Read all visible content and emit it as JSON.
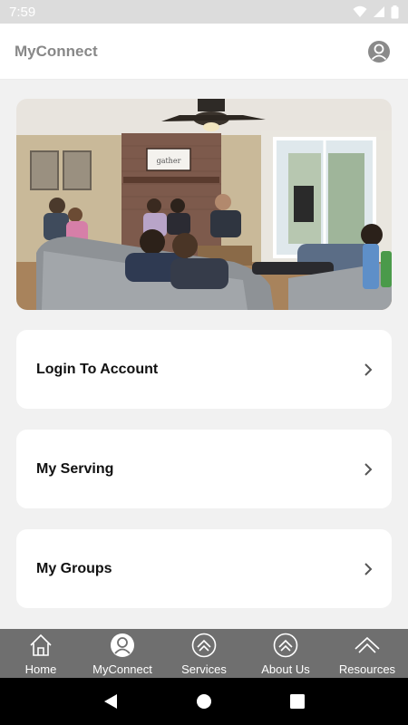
{
  "status_bar": {
    "time": "7:59",
    "icons": [
      "wifi-icon",
      "signal-icon",
      "battery-icon"
    ]
  },
  "header": {
    "title": "MyConnect",
    "profile_icon": "account-circle-icon"
  },
  "hero": {
    "image": "photo of a group gathered in a living room"
  },
  "cards": [
    {
      "label": "Login To Account",
      "icon": "chevron-right-icon"
    },
    {
      "label": "My Serving",
      "icon": "chevron-right-icon"
    },
    {
      "label": "My Groups",
      "icon": "chevron-right-icon"
    }
  ],
  "tabs": [
    {
      "label": "Home",
      "icon": "home-icon"
    },
    {
      "label": "MyConnect",
      "icon": "account-circle-icon"
    },
    {
      "label": "Services",
      "icon": "chevron-up-circle-icon"
    },
    {
      "label": "About Us",
      "icon": "chevron-up-circle-icon"
    },
    {
      "label": "Resources",
      "icon": "chevron-up-icon"
    }
  ],
  "system_nav": [
    "back-icon",
    "home-circle-icon",
    "recents-icon"
  ],
  "colors": {
    "tab_bar": "#6f6f6f",
    "background": "#f1f1f1",
    "header_title": "#888888",
    "status_bar": "#dcdcdc"
  }
}
